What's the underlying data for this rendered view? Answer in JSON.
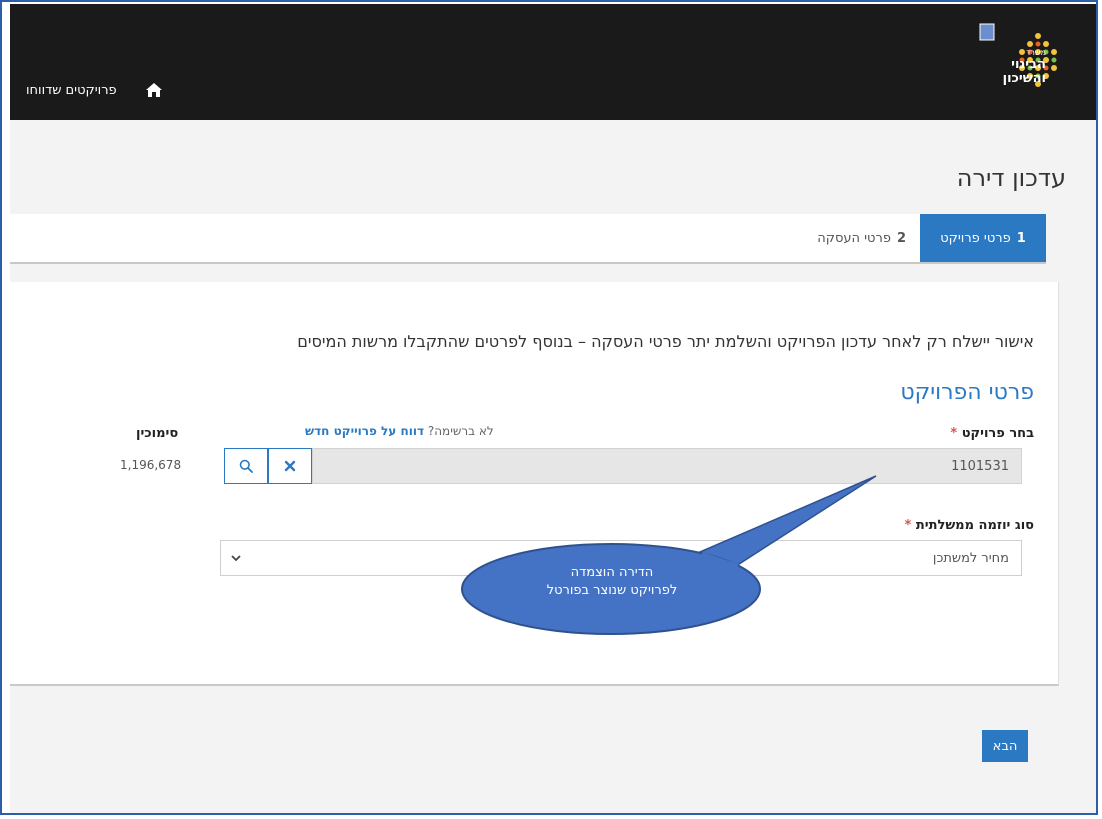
{
  "header": {
    "logo_small": "משרד",
    "logo_line1": "הבינוי",
    "logo_line2": "והשיכון",
    "nav_link": "פרויקטים שדווחו"
  },
  "page": {
    "title": "עדכון דירה"
  },
  "tabs": [
    {
      "num": "1",
      "label": "פרטי פרויקט",
      "active": true
    },
    {
      "num": "2",
      "label": "פרטי העסקה",
      "active": false
    }
  ],
  "form": {
    "notice": "אישור יישלח רק לאחר עדכון הפרויקט והשלמת יתר פרטי העסקה – בנוסף לפרטים שהתקבלו מרשות המיסים",
    "section_title": "פרטי הפרויקט",
    "project_label": "בחר פרויקט",
    "required_mark": "*",
    "hint_prefix": "לא ברשימה?",
    "hint_link": "דווח על פרוייקט חדש",
    "simucin_label": "סימוכין",
    "project_value": "1101531",
    "simucin_value": "1,196,678",
    "initiative_label": "סוג יוזמה ממשלתית",
    "initiative_value": "מחיר למשתכן"
  },
  "callout": {
    "line1": "הדירה הוצמדה",
    "line2": "לפרויקט שנוצר בפורטל"
  },
  "actions": {
    "next": "הבא"
  },
  "colors": {
    "header_bg": "#1a1a1a",
    "accent": "#2b79c2",
    "callout": "#4472c4",
    "required": "#d9534f"
  },
  "icons": [
    "home-icon",
    "search-icon",
    "clear-icon",
    "chevron-down-icon",
    "ministry-logo-icon"
  ]
}
